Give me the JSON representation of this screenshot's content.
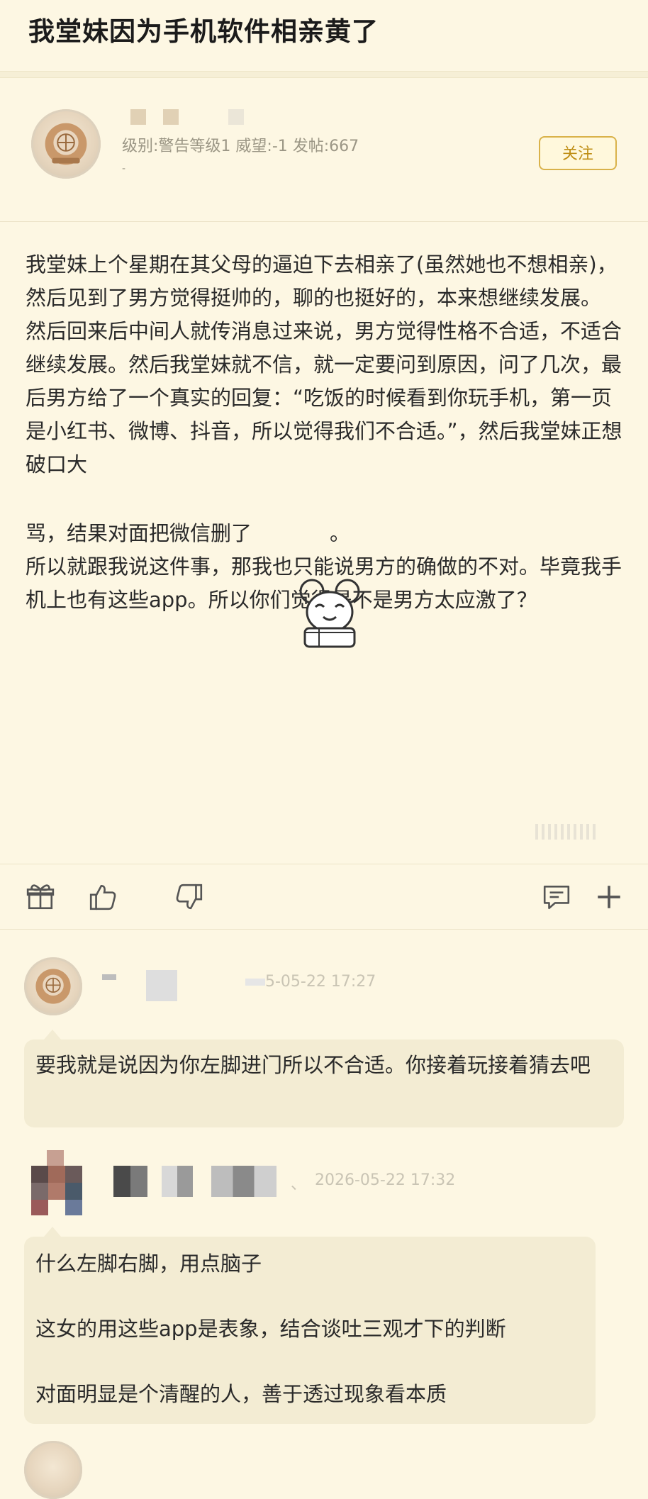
{
  "page": {
    "title": "我堂妹因为手机软件相亲黄了"
  },
  "author": {
    "meta": "级别:警告等级1 威望:-1 发帖:667",
    "follow_label": "关注"
  },
  "post": {
    "paragraph_1": "我堂妹上个星期在其父母的逼迫下去相亲了(虽然她也不想相亲)，然后见到了男方觉得挺帅的，聊的也挺好的，本来想继续发展。",
    "paragraph_2_a": "然后回来后中间人就传消息过来说，男方觉得性格不合适，不适合继续发展。然后我堂妹就不信，就一定要问到原因，问了几次，最后男方给了一个真实的回复：“吃饭的时候看到你玩手机，第一页是小红书、微博、抖音，所以觉得我们不合适。”，然后我堂妹正想破口大",
    "paragraph_2_b_before": "骂，结果对面把微信删了",
    "paragraph_2_b_after": "。",
    "paragraph_3": "所以就跟我说这件事，那我也只能说男方的确做的不对。毕竟我手机上也有这些app。所以你们觉得是不是男方太应激了？"
  },
  "toolbar": {
    "icons": [
      "gift-icon",
      "thumbs-up-icon",
      "thumbs-down-icon",
      "comment-icon",
      "plus-icon"
    ]
  },
  "comments": [
    {
      "date": "5-05-22 17:27",
      "text": "要我就是说因为你左脚进门所以不合适。你接着玩接着猜去吧"
    },
    {
      "date": "2026-05-22 17:32",
      "lines": [
        "什么左脚右脚，用点脑子",
        "这女的用这些app是表象，结合谈吐三观才下的判断",
        "对面明显是个清醒的人，善于透过现象看本质"
      ]
    }
  ],
  "colors": {
    "background": "#fdf7e3",
    "follow_border": "#d9b24a",
    "follow_text": "#bf8e15",
    "bubble": "#f3ecd3"
  }
}
